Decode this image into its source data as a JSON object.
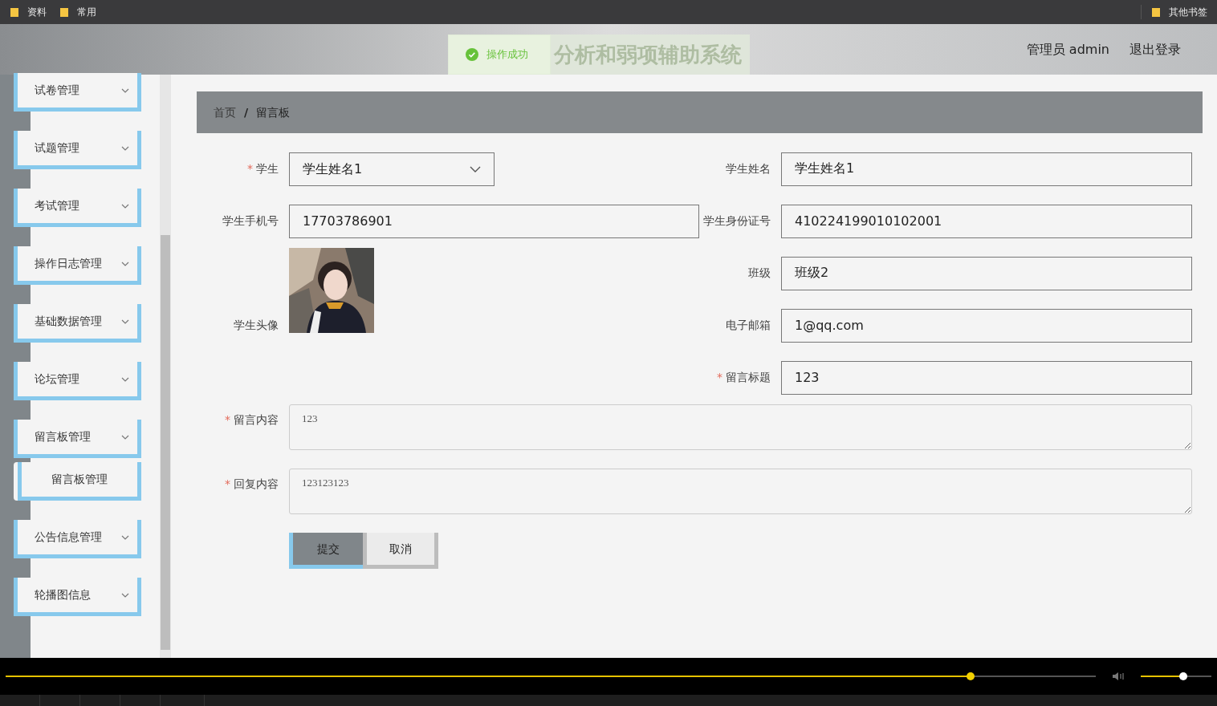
{
  "bookmarks_bar": {
    "left": [
      {
        "label": "资料"
      },
      {
        "label": "常用"
      }
    ],
    "right": [
      {
        "label": "其他书签"
      }
    ]
  },
  "header": {
    "title": "分析和弱项辅助系统",
    "toast": {
      "kind": "success",
      "text": "操作成功"
    },
    "user": "管理员 admin",
    "logout": "退出登录"
  },
  "sidebar": {
    "items": [
      {
        "label": "试卷管理"
      },
      {
        "label": "试题管理"
      },
      {
        "label": "考试管理"
      },
      {
        "label": "操作日志管理"
      },
      {
        "label": "基础数据管理"
      },
      {
        "label": "论坛管理"
      },
      {
        "label": "留言板管理",
        "children": [
          {
            "label": "留言板管理"
          }
        ]
      },
      {
        "label": "公告信息管理"
      },
      {
        "label": "轮播图信息"
      }
    ]
  },
  "breadcrumb": [
    {
      "label": "首页"
    },
    {
      "label": "/"
    },
    {
      "label": "留言板"
    }
  ],
  "form": {
    "left_fields": [
      {
        "kind": "select",
        "required_mark": "*",
        "label": "学生",
        "value": "学生姓名1"
      },
      {
        "kind": "text",
        "label": "学生手机号",
        "value": "17703786901"
      },
      {
        "label": "学生头像"
      }
    ],
    "right_fields": [
      {
        "kind": "text",
        "label": "学生姓名",
        "value": "学生姓名1"
      },
      {
        "kind": "text",
        "label": "学生身份证号",
        "value": "410224199010102001"
      },
      {
        "kind": "text",
        "label": "班级",
        "value": "班级2"
      },
      {
        "kind": "text",
        "label": "电子邮箱",
        "value": "1@qq.com"
      },
      {
        "kind": "text",
        "required_mark": "*",
        "label": "留言标题",
        "value": "123"
      }
    ],
    "wide_fields": [
      {
        "kind": "textarea",
        "required_mark": "*",
        "label": "留言内容",
        "value": "123"
      },
      {
        "kind": "textarea",
        "required_mark": "*",
        "label": "回复内容",
        "value": "123123123"
      }
    ],
    "buttons": [
      {
        "label": "提交",
        "kind": "primary"
      },
      {
        "label": "取消",
        "kind": "default"
      }
    ]
  },
  "player": {
    "progress": {
      "level": 0.885
    },
    "volume": {
      "level": 0.6
    }
  }
}
